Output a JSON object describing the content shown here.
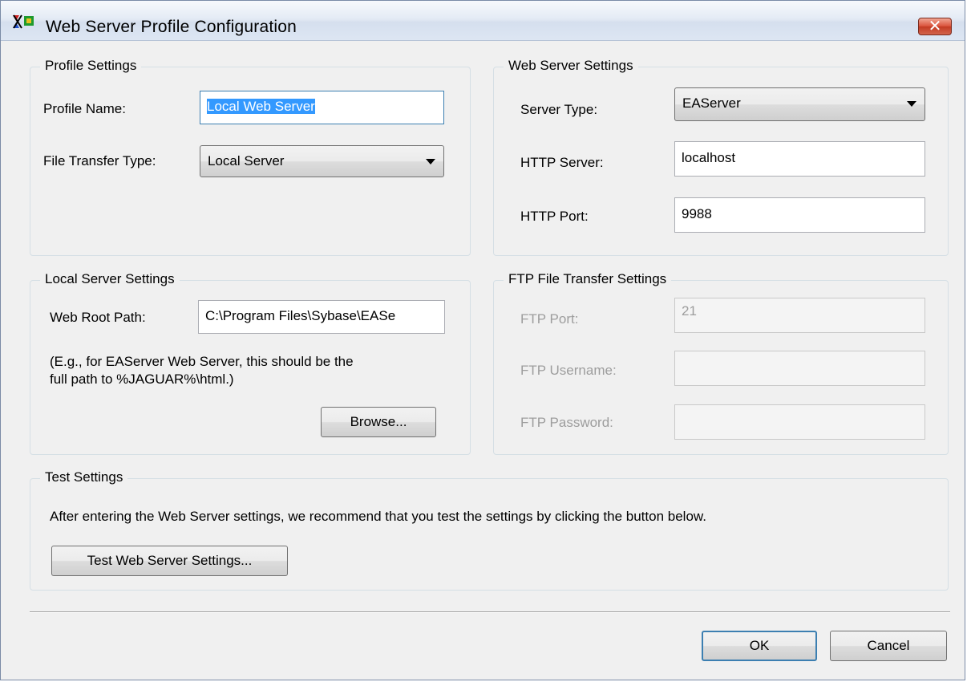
{
  "window": {
    "title": "Web Server Profile Configuration",
    "icon": "app-icon",
    "close_icon": "close-icon"
  },
  "profile_settings": {
    "legend": "Profile Settings",
    "profile_name_label": "Profile Name:",
    "profile_name_value": "Local Web Server",
    "file_transfer_label": "File Transfer Type:",
    "file_transfer_value": "Local Server"
  },
  "web_server_settings": {
    "legend": "Web Server Settings",
    "server_type_label": "Server Type:",
    "server_type_value": "EAServer",
    "http_server_label": "HTTP Server:",
    "http_server_value": "localhost",
    "http_port_label": "HTTP Port:",
    "http_port_value": "9988"
  },
  "local_server_settings": {
    "legend": "Local Server Settings",
    "web_root_label": "Web Root Path:",
    "web_root_value": "C:\\Program Files\\Sybase\\EASe",
    "hint_line1": "(E.g., for EAServer Web Server, this should be the",
    "hint_line2": "full path to %JAGUAR%\\html.)",
    "browse_label": "Browse..."
  },
  "ftp_settings": {
    "legend": "FTP File Transfer Settings",
    "port_label": "FTP Port:",
    "port_value": "21",
    "username_label": "FTP Username:",
    "username_value": "",
    "password_label": "FTP Password:",
    "password_value": ""
  },
  "test_settings": {
    "legend": "Test Settings",
    "description": "After entering the Web Server settings, we recommend that you test the settings by clicking the button below.",
    "test_button": "Test Web Server Settings..."
  },
  "footer": {
    "ok_label": "OK",
    "cancel_label": "Cancel"
  }
}
